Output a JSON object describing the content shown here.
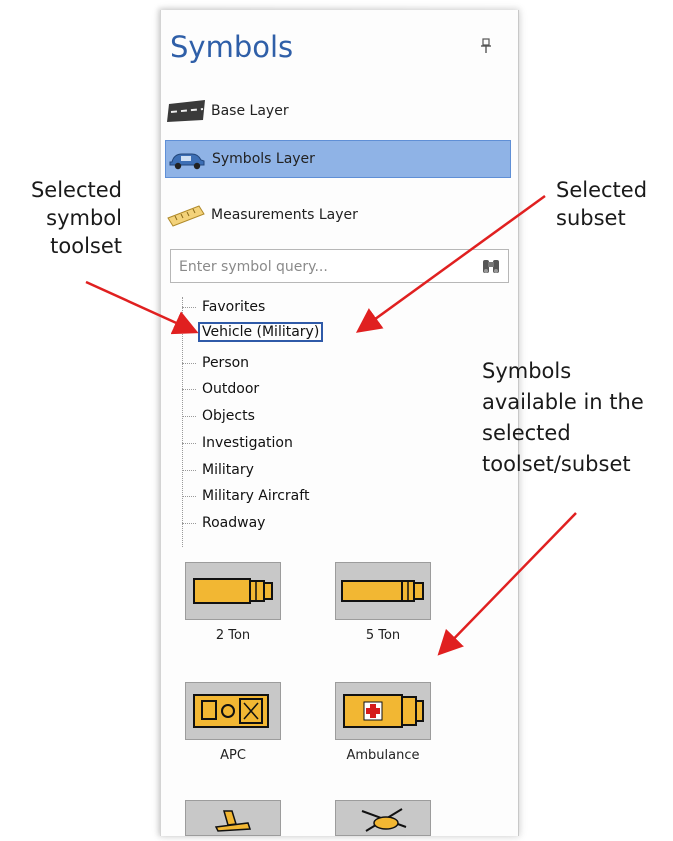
{
  "panel": {
    "title": "Symbols",
    "layers": [
      {
        "label": "Base Layer",
        "icon": "road-icon",
        "selected": false
      },
      {
        "label": "Symbols Layer",
        "icon": "car-icon",
        "selected": true
      },
      {
        "label": "Measurements Layer",
        "icon": "ruler-icon",
        "selected": false
      }
    ],
    "search": {
      "placeholder": "Enter symbol query..."
    },
    "toolsets": [
      "Favorites",
      "Vehicle (Military)",
      "Person",
      "Outdoor",
      "Objects",
      "Investigation",
      "Military",
      "Military Aircraft",
      "Roadway"
    ],
    "selected_toolset": "Vehicle (Military)",
    "symbols": [
      {
        "label": "2 Ton",
        "icon": "truck-2ton-icon"
      },
      {
        "label": "5 Ton",
        "icon": "truck-5ton-icon"
      },
      {
        "label": "APC",
        "icon": "apc-icon"
      },
      {
        "label": "Ambulance",
        "icon": "ambulance-icon"
      },
      {
        "label": "",
        "icon": "aircraft-icon"
      },
      {
        "label": "",
        "icon": "helicopter-icon"
      }
    ]
  },
  "annotations": {
    "selected_toolset": [
      "Selected",
      "symbol",
      "toolset"
    ],
    "selected_subset": [
      "Selected",
      "subset"
    ],
    "symbols_available": [
      "Symbols",
      "available in the",
      "selected",
      "toolset/subset"
    ]
  },
  "colors": {
    "title": "#2f5fa8",
    "selected_layer": "#8fb3e6",
    "selected_toolset_border": "#2f5aa8",
    "arrow": "#e02020",
    "symbol_fill": "#f2b733"
  }
}
